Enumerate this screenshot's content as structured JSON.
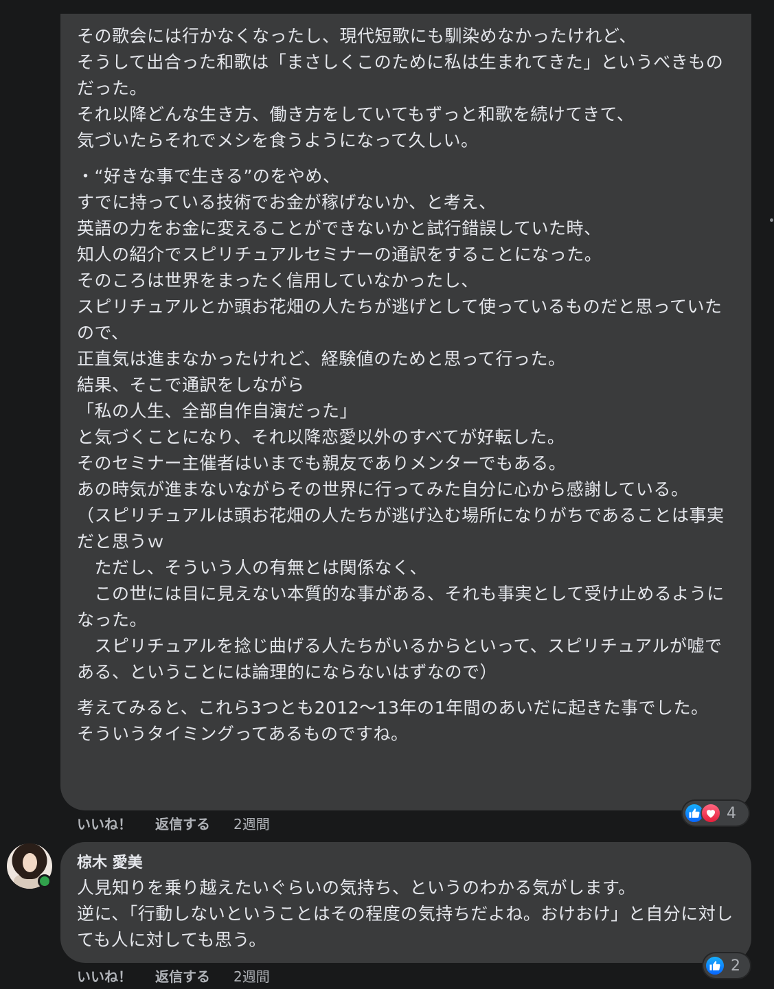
{
  "comment1": {
    "paragraphs": [
      "その歌会には行かなくなったし、現代短歌にも馴染めなかったけれど、\nそうして出合った和歌は「まさしくこのために私は生まれてきた」というべきものだった。\nそれ以降どんな生き方、働き方をしていてもずっと和歌を続けてきて、\n気づいたらそれでメシを食うようになって久しい。",
      "・“好きな事で生きる”のをやめ、\nすでに持っている技術でお金が稼げないか、と考え、\n英語の力をお金に変えることができないかと試行錯誤していた時、\n知人の紹介でスピリチュアルセミナーの通訳をすることになった。\nそのころは世界をまったく信用していなかったし、\nスピリチュアルとか頭お花畑の人たちが逃げとして使っているものだと思っていたので、\n正直気は進まなかったけれど、経験値のためと思って行った。\n結果、そこで通訳をしながら\n「私の人生、全部自作自演だった」\nと気づくことになり、それ以降恋愛以外のすべてが好転した。\nそのセミナー主催者はいまでも親友でありメンターでもある。\nあの時気が進まないながらその世界に行ってみた自分に心から感謝している。\n（スピリチュアルは頭お花畑の人たちが逃げ込む場所になりがちであることは事実だと思うｗ\n　ただし、そういう人の有無とは関係なく、\n　この世には目に見えない本質的な事がある、それも事実として受け止めるようになった。\n　スピリチュアルを捻じ曲げる人たちがいるからといって、スピリチュアルが嘘である、ということには論理的にならないはずなので）",
      "考えてみると、これら3つとも2012〜13年の1年間のあいだに起きた事でした。\nそういうタイミングってあるものですね。"
    ],
    "reaction_count": "4",
    "like_label": "いいね！",
    "reply_label": "返信する",
    "time": "2週間"
  },
  "comment2": {
    "author": "椋木 愛美",
    "paragraphs": [
      "人見知りを乗り越えたいぐらいの気持ち、というのわかる気がします。\n逆に、「行動しないということはその程度の気持ちだよね。おけおけ」と自分に対しても人に対しても思う。"
    ],
    "reaction_count": "2",
    "like_label": "いいね！",
    "reply_label": "返信する",
    "time": "2週間"
  },
  "colors": {
    "background": "#18191a",
    "bubble": "#3a3b3c",
    "like_blue": "#0866ff",
    "love_red": "#e61e3a",
    "online_green": "#31a24c"
  },
  "icons": [
    "like-icon",
    "love-icon",
    "avatar",
    "online-status-icon"
  ]
}
